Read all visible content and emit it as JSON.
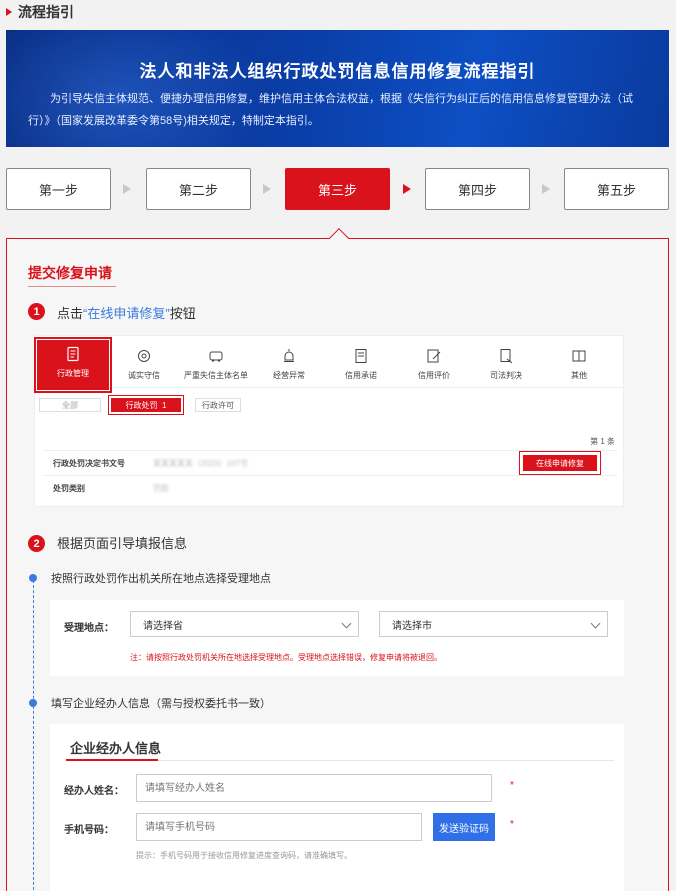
{
  "section": {
    "title": "流程指引"
  },
  "banner": {
    "title": "法人和非法人组织行政处罚信息信用修复流程指引",
    "desc": "为引导失信主体规范、便捷办理信用修复，维护信用主体合法权益，根据《失信行为纠正后的信用信息修复管理办法（试行）》（国家发展改革委令第58号)相关规定，特制定本指引。"
  },
  "steps": [
    {
      "label": "第一步",
      "active": false
    },
    {
      "label": "第二步",
      "active": false
    },
    {
      "label": "第三步",
      "active": true
    },
    {
      "label": "第四步",
      "active": false
    },
    {
      "label": "第五步",
      "active": false
    }
  ],
  "content": {
    "title": "提交修复申请",
    "step1": {
      "num": "1",
      "prefix": "点击",
      "highlight": "“在线申请修复”",
      "suffix": "按钮"
    },
    "step2": {
      "num": "2",
      "text": "根据页面引导填报信息"
    }
  },
  "screenshot": {
    "tabs": [
      {
        "label": "行政管理",
        "icon": "document-icon"
      },
      {
        "label": "诚实守信",
        "icon": "medal-icon"
      },
      {
        "label": "严重失信主体名单",
        "icon": "car-icon"
      },
      {
        "label": "经营异常",
        "icon": "alarm-icon"
      },
      {
        "label": "信用承诺",
        "icon": "file-icon"
      },
      {
        "label": "信用评价",
        "icon": "edit-icon"
      },
      {
        "label": "司法判决",
        "icon": "gavel-doc-icon"
      },
      {
        "label": "其他",
        "icon": "book-icon"
      }
    ],
    "subtabs": {
      "all": "全部",
      "penalty": "行政处罚",
      "penalty_count": "1",
      "permit": "行政许可"
    },
    "count": "第 1 条",
    "rows": [
      {
        "key": "行政处罚决定书文号",
        "value": "某某某某某（2023）107号"
      },
      {
        "key": "处罚类别",
        "value": "罚款"
      }
    ],
    "apply_button": "在线申请修复"
  },
  "location": {
    "bullet": "按照行政处罚作出机关所在地点选择受理地点",
    "label": "受理地点：",
    "province_placeholder": "请选择省",
    "city_placeholder": "请选择市",
    "note": "注：请按照行政处罚机关所在地选择受理地点。受理地点选择错误，修复申请将被退回。"
  },
  "agent": {
    "bullet": "填写企业经办人信息（需与授权委托书一致）",
    "panel_title": "企业经办人信息",
    "name_label": "经办人姓名：",
    "name_placeholder": "请填写经办人姓名",
    "phone_label": "手机号码：",
    "phone_placeholder": "请填写手机号码",
    "send_code": "发送验证码",
    "required_mark": "*",
    "hint": "提示：手机号码用于接收信用修复进度查询码，请准确填写。"
  },
  "colors": {
    "accent": "#d9121b",
    "link": "#3b7be0",
    "banner": "#0a3ea8",
    "button_blue": "#2f6fe8"
  }
}
